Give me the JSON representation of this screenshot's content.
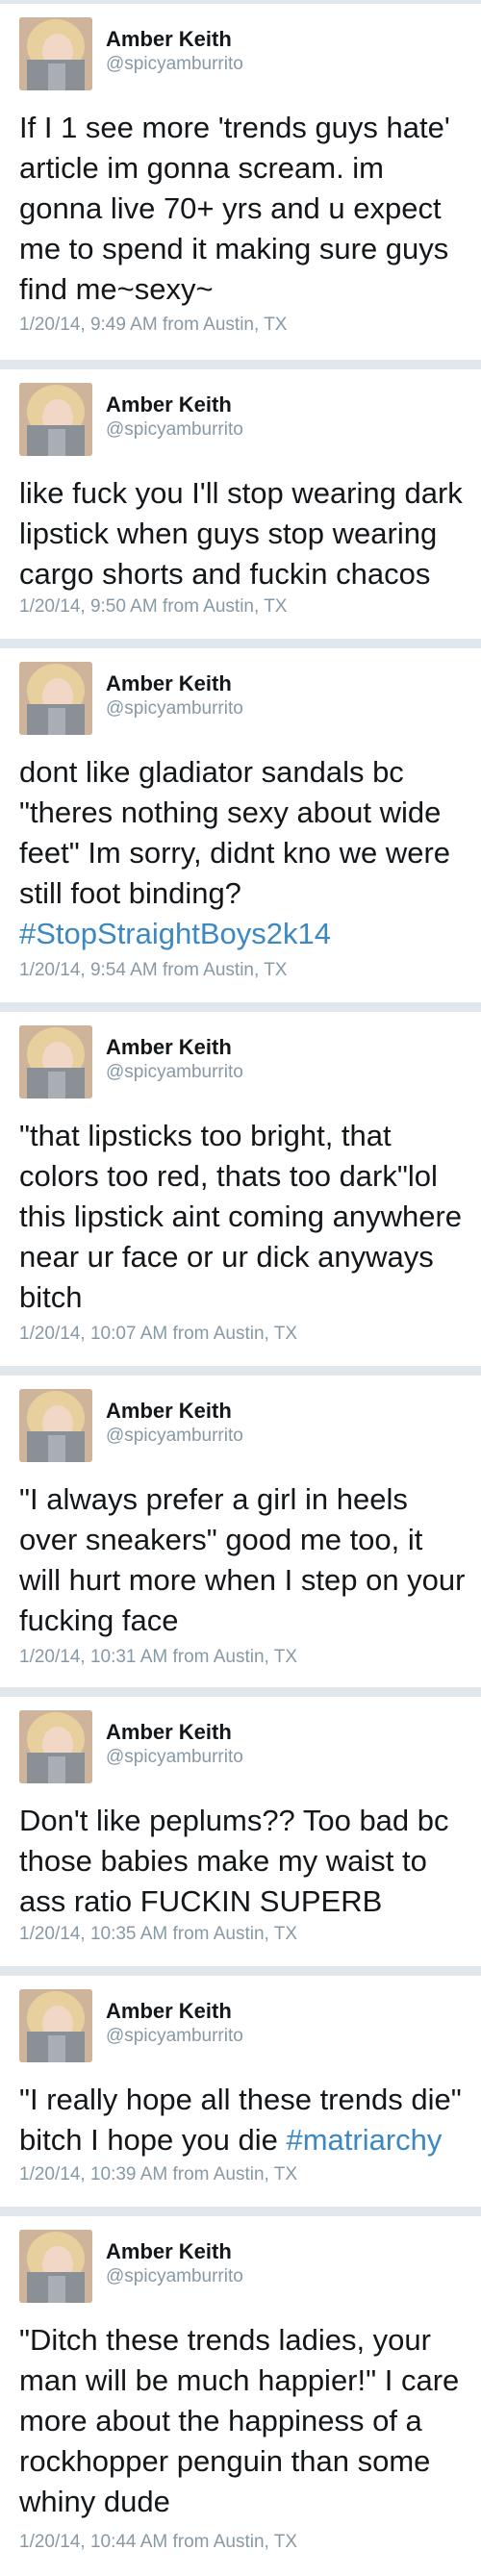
{
  "author": {
    "name": "Amber Keith",
    "handle": "@spicyamburrito",
    "avatar_icon": "profile-photo"
  },
  "tweets": [
    {
      "text": "If I 1 see more 'trends guys hate' article im gonna scream. im gonna live 70+ yrs and u expect me to spend it making sure guys find me~sexy~",
      "time": "1/20/14, 9:49 AM from Austin, TX"
    },
    {
      "text": "like fuck you I'll stop wearing dark lipstick when guys stop wearing cargo shorts and fuckin chacos",
      "time": "1/20/14, 9:50 AM from Austin, TX"
    },
    {
      "text_before": "dont like gladiator sandals bc \"theres nothing sexy about wide feet\" Im sorry, didnt kno we were still foot binding? ",
      "hashtag": "#StopStraightBoys2k14",
      "time": "1/20/14, 9:54 AM from Austin, TX"
    },
    {
      "text": "\"that lipsticks too bright, that colors too red, thats too dark\"lol this lipstick aint coming anywhere near ur face or ur dick anyways bitch",
      "time": "1/20/14, 10:07 AM from Austin, TX"
    },
    {
      "text": "\"I always prefer a girl in heels over sneakers\" good me too, it will hurt more when I step on your fucking face",
      "time": "1/20/14, 10:31 AM from Austin, TX"
    },
    {
      "text": "Don't like peplums?? Too bad bc those babies make my waist to ass ratio FUCKIN SUPERB",
      "time": "1/20/14, 10:35 AM from Austin, TX"
    },
    {
      "text_before": "\"I really hope all these trends die\" bitch I hope you die ",
      "hashtag": "#matriarchy",
      "time": "1/20/14, 10:39 AM from Austin, TX"
    },
    {
      "text": "\"Ditch these trends ladies, your man will be much happier!\" I care more about the happiness of a rockhopper penguin than some whiny dude",
      "time": "1/20/14, 10:44 AM from Austin, TX"
    }
  ],
  "colors": {
    "separator": "#e1e8ed",
    "hashtag": "#3b88c3",
    "meta": "#8899a6"
  }
}
